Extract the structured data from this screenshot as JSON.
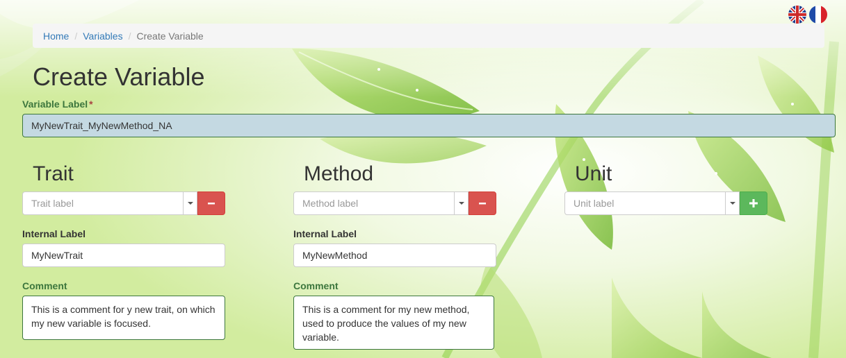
{
  "languages": [
    {
      "name": "english-flag"
    },
    {
      "name": "french-flag"
    }
  ],
  "breadcrumb": {
    "items": [
      "Home",
      "Variables"
    ],
    "current": "Create Variable"
  },
  "page": {
    "title": "Create Variable"
  },
  "variable_label": {
    "label": "Variable Label",
    "required_mark": "*",
    "value": "MyNewTrait_MyNewMethod_NA"
  },
  "trait": {
    "heading": "Trait",
    "placeholder": "Trait label",
    "internal_label": "Internal Label",
    "internal_value": "MyNewTrait",
    "comment_label": "Comment",
    "comment_value": "This is a comment for y new trait, on which my new variable is focused.",
    "button_icon": "minus-icon"
  },
  "method": {
    "heading": "Method",
    "placeholder": "Method label",
    "internal_label": "Internal Label",
    "internal_value": "MyNewMethod",
    "comment_label": "Comment",
    "comment_value": "This is a comment for my new method, used to produce the values of my new variable.",
    "button_icon": "minus-icon"
  },
  "unit": {
    "heading": "Unit",
    "placeholder": "Unit label",
    "button_icon": "plus-icon"
  },
  "colors": {
    "link": "#337ab7",
    "success_label": "#3c763d",
    "danger_button": "#d9534f",
    "success_button": "#5cb85c",
    "variable_field_bg": "#c4d9e2"
  }
}
